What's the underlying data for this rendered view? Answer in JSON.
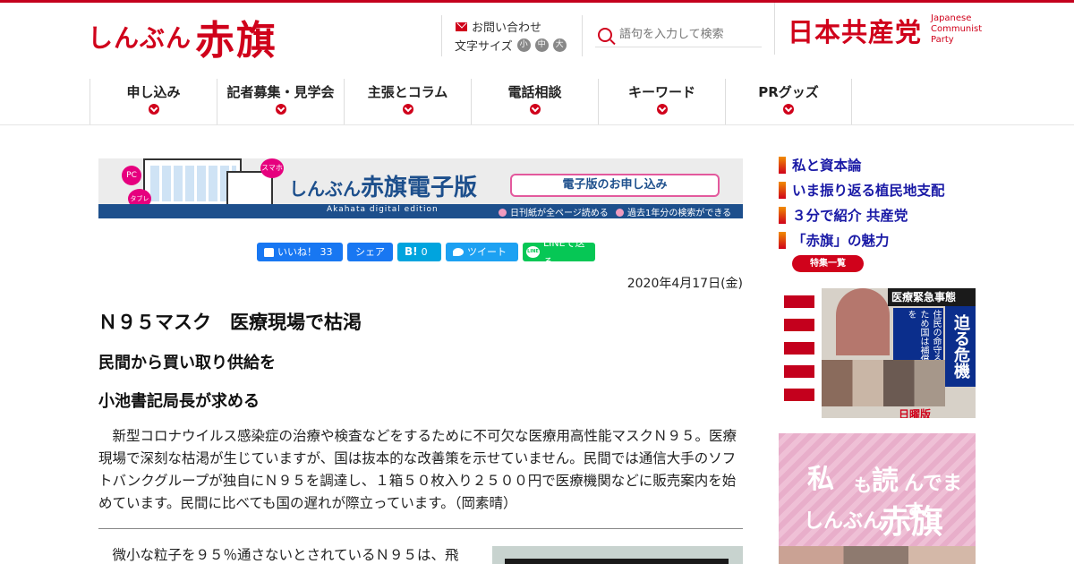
{
  "header": {
    "logo_small": "しんぶん",
    "logo_big": "赤旗",
    "contact": "お問い合わせ",
    "fontsize_label": "文字サイズ",
    "fontsize_options": [
      "小",
      "中",
      "大"
    ],
    "search_placeholder": "語句を入力して検索",
    "party_logo": "日本共産党",
    "party_en": "Japanese Communist Party"
  },
  "nav": [
    {
      "label": "申し込み"
    },
    {
      "label": "記者募集・見学会"
    },
    {
      "label": "主張とコラム"
    },
    {
      "label": "電話相談"
    },
    {
      "label": "キーワード"
    },
    {
      "label": "PRグッズ"
    }
  ],
  "banner": {
    "tag_pc": "PC",
    "tag_tablet": "タブレット",
    "tag_phone": "スマホ",
    "title_small": "しんぶん",
    "title": "赤旗電子版",
    "subtitle": "Akahata digital edition",
    "button": "電子版のお申し込み",
    "feature1": "日刊紙が全ページ読める",
    "feature2": "過去1年分の検索ができる"
  },
  "share": {
    "facebook_like": "いいね！ 33",
    "facebook_share": "シェア",
    "hatena_count": "0",
    "tweet": "ツイート",
    "line": "LINEで送る"
  },
  "article": {
    "date": "2020年4月17日(金)",
    "title": "Ｎ９５マスク　医療現場で枯渇",
    "subtitle1": "民間から買い取り供給を",
    "subtitle2": "小池書記局長が求める",
    "lead": "　新型コロナウイルス感染症の治療や検査などをするために不可欠な医療用高性能マスクＮ９５。医療現場で深刻な枯渇が生じていますが、国は抜本的な改善策を示せていません。民間では通信大手のソフトバンクグループが独自にＮ９５を調達し、１箱５０枚入り２５００円で医療機関などに販売案内を始めています。民間に比べても国の遅れが際立っています。（岡素晴）",
    "body_start": "　微小な粒子を９５％通さないとされているＮ９５は、飛"
  },
  "sidebar": {
    "links": [
      "私と資本論",
      "いま振り返る植民地支配",
      "３分で紹介 共産党",
      "「赤旗」の魅力"
    ],
    "feature_button": "特集一覧",
    "cover": {
      "headline": "医療緊急事態",
      "semaru": "迫る危機",
      "jumin": "住民の命守るため国は補償を",
      "sunday": "日曜版"
    },
    "ad": {
      "w1": "私",
      "w2": "も",
      "w3": "読",
      "w4": "んでます",
      "w5": "しんぶん",
      "w6": "赤旗"
    }
  },
  "colors": {
    "brand_red": "#d0021b",
    "link_blue": "#1a1aa6",
    "digital_blue": "#1d4f8c"
  }
}
